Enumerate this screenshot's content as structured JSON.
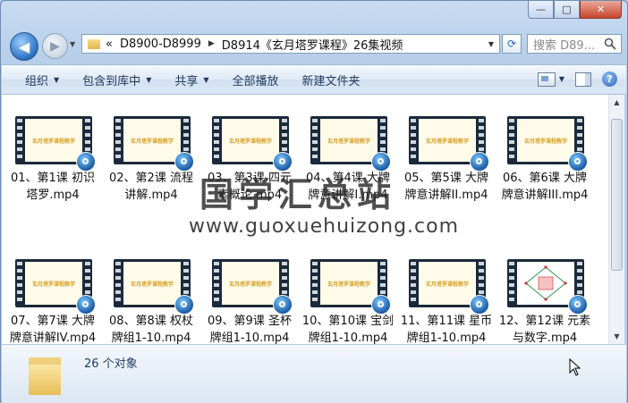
{
  "window": {
    "caption": {
      "minimize": "—",
      "maximize": "□",
      "close": "✕"
    }
  },
  "address_bar": {
    "overflow": "«",
    "segments": [
      "D8900-D8999",
      "D8914《玄月塔罗课程》26集视频"
    ],
    "search_placeholder": "搜索 D89..."
  },
  "toolbar": {
    "items": [
      {
        "label": "组织",
        "dropdown": true
      },
      {
        "label": "包含到库中",
        "dropdown": true
      },
      {
        "label": "共享",
        "dropdown": true
      },
      {
        "label": "全部播放",
        "dropdown": false
      },
      {
        "label": "新建文件夹",
        "dropdown": false
      }
    ]
  },
  "thumbnail_caption": "玄月塔罗课程教学",
  "files": [
    {
      "name": "01、第1课 初识塔罗.mp4"
    },
    {
      "name": "02、第2课 流程讲解.mp4"
    },
    {
      "name": "03、第3课 四元素概论.mp4"
    },
    {
      "name": "04、第4课 大牌牌意讲解I.mp4"
    },
    {
      "name": "05、第5课 大牌牌意讲解II.mp4"
    },
    {
      "name": "06、第6课 大牌牌意讲解III.mp4"
    },
    {
      "name": "07、第7课 大牌牌意讲解IV.mp4"
    },
    {
      "name": "08、第8课 权杖牌组1-10.mp4"
    },
    {
      "name": "09、第9课 圣杯牌组1-10.mp4"
    },
    {
      "name": "10、第10课 宝剑牌组1-10.mp4"
    },
    {
      "name": "11、第11课 星币牌组1-10.mp4"
    },
    {
      "name": "12、第12课 元素与数字.mp4"
    }
  ],
  "details": {
    "count_text": "26 个对象"
  },
  "watermark": {
    "line1": "国学汇总站",
    "line2": "www.guoxuehuizong.com"
  },
  "colors": {
    "accent": "#2a6fc1",
    "toolbar_text": "#1e395b",
    "thumb_text": "#d9a32b"
  }
}
